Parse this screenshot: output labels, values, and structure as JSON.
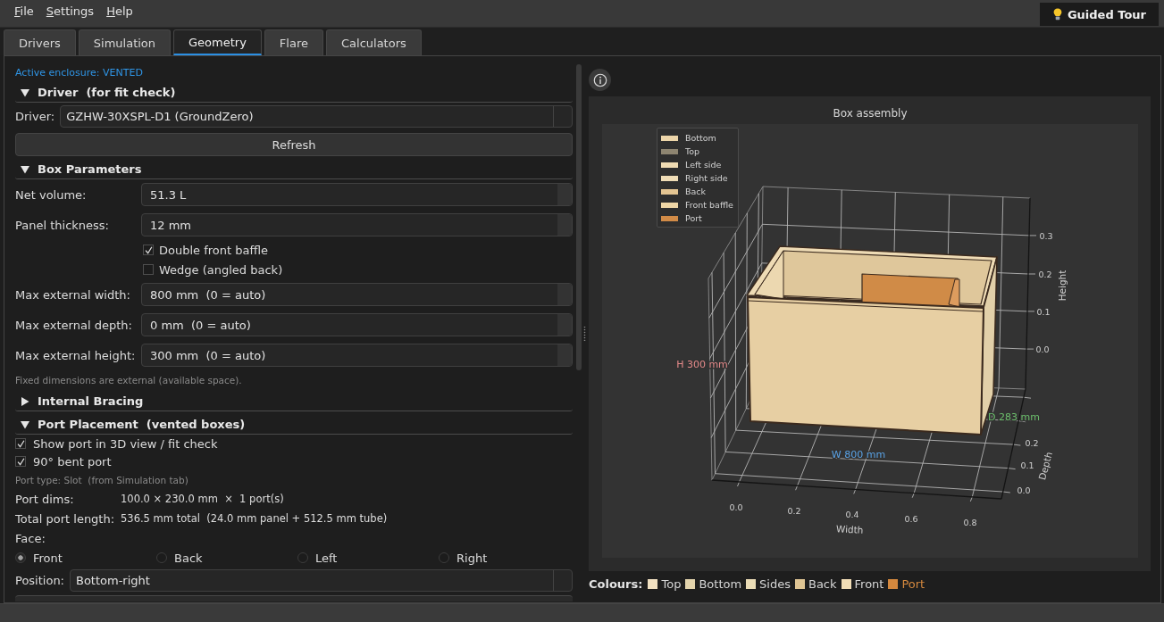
{
  "menu": [
    {
      "label": "File"
    },
    {
      "label": "Settings"
    },
    {
      "label": "Help"
    }
  ],
  "guided_tour_button": {
    "label": "Guided Tour"
  },
  "tabs": [
    {
      "label": "Drivers",
      "selected": false
    },
    {
      "label": "Simulation",
      "selected": false
    },
    {
      "label": "Geometry",
      "selected": true
    },
    {
      "label": "Flare",
      "selected": false
    },
    {
      "label": "Calculators",
      "selected": false
    }
  ],
  "left_panel": {
    "status": "Active enclosure: VENTED",
    "sections": [
      {
        "title": "Driver  (for fit check)",
        "expanded": true,
        "rows": [
          {
            "kind": "combo",
            "label": "Driver:",
            "value": "GZHW-30XSPL-D1 (GroundZero)"
          },
          {
            "kind": "button",
            "label": "Refresh"
          }
        ]
      },
      {
        "title": "Box Parameters",
        "expanded": true,
        "rows": [
          {
            "kind": "spin",
            "label": "Net volume:",
            "value": "51.3 L"
          },
          {
            "kind": "spin",
            "label": "Panel thickness:",
            "value": "12 mm"
          },
          {
            "kind": "option",
            "label": "Double front baffle",
            "checked": true
          },
          {
            "kind": "option",
            "label": "Wedge (angled back)",
            "checked": false
          },
          {
            "kind": "spin",
            "label": "Max external width:",
            "value": "800 mm  (0 = auto)"
          },
          {
            "kind": "spin",
            "label": "Max external depth:",
            "value": "0 mm  (0 = auto)"
          },
          {
            "kind": "spin",
            "label": "Max external height:",
            "value": "300 mm  (0 = auto)"
          },
          {
            "kind": "hint",
            "text": "Fixed dimensions are external (available space)."
          }
        ]
      },
      {
        "title": "Internal Bracing",
        "expanded": false
      },
      {
        "title": "Port Placement  (vented boxes)",
        "expanded": true,
        "rows": [
          {
            "kind": "checkbox",
            "label": "Show port in 3D view / fit check",
            "checked": true
          },
          {
            "kind": "checkbox",
            "label": "90° bent port",
            "checked": true
          },
          {
            "kind": "hint",
            "text": "Port type: Slot  (from Simulation tab)"
          },
          {
            "kind": "pair",
            "label": "Port dims:",
            "value": "100.0 × 230.0 mm  ×  1 port(s)"
          },
          {
            "kind": "pair",
            "label": "Total port length:",
            "value": "536.5 mm total  (24.0 mm panel + 512.5 mm tube)"
          },
          {
            "kind": "heading",
            "label": "Face:"
          },
          {
            "kind": "radios",
            "options": [
              {
                "label": "Front",
                "selected": true
              },
              {
                "label": "Back",
                "selected": false
              },
              {
                "label": "Left",
                "selected": false
              },
              {
                "label": "Right",
                "selected": false
              }
            ]
          },
          {
            "kind": "combo",
            "label": "Position:",
            "value": "Bottom-right"
          }
        ]
      }
    ]
  },
  "plot": {
    "title": "Box assembly",
    "legend": [
      {
        "label": "Bottom",
        "color": "#ecd5a9"
      },
      {
        "label": "Top",
        "color": "#8e8571"
      },
      {
        "label": "Left side",
        "color": "#efdbb3"
      },
      {
        "label": "Right side",
        "color": "#efdcb6"
      },
      {
        "label": "Back",
        "color": "#e4c592"
      },
      {
        "label": "Front baffle",
        "color": "#efd6a6"
      },
      {
        "label": "Port",
        "color": "#d18b47"
      }
    ],
    "axes": [
      {
        "kind": "height",
        "label": "Height",
        "ticks": [
          "0.3",
          "0.2",
          "0.1",
          "0.0"
        ]
      },
      {
        "kind": "depth",
        "label": "Depth",
        "ticks": [
          "0.2",
          "0.1",
          "0.0"
        ]
      },
      {
        "kind": "width",
        "label": "Width",
        "ticks": [
          "0.0",
          "0.2",
          "0.4",
          "0.6",
          "0.8"
        ]
      }
    ],
    "annotations": [
      {
        "kind": "height",
        "text": "H 300 mm",
        "color": "#e58a8a"
      },
      {
        "kind": "depth",
        "text": "D 283 mm",
        "color": "#6cbf6c"
      },
      {
        "kind": "width",
        "text": "W 800 mm",
        "color": "#5aa3e6"
      }
    ]
  },
  "colours": {
    "label": "Colours:",
    "items": [
      {
        "label": "Top",
        "color": "#f1e0c1",
        "highlighted": false
      },
      {
        "label": "Bottom",
        "color": "#e3d4ad",
        "highlighted": false
      },
      {
        "label": "Sides",
        "color": "#eadcb6",
        "highlighted": false
      },
      {
        "label": "Back",
        "color": "#dfc594",
        "highlighted": false
      },
      {
        "label": "Front",
        "color": "#f2deb7",
        "highlighted": false
      },
      {
        "label": "Port",
        "color": "#d4883e",
        "highlighted": true
      }
    ]
  }
}
